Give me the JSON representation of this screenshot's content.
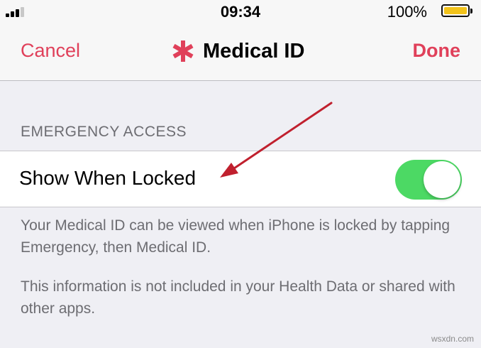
{
  "status_bar": {
    "time": "09:34",
    "battery_percent": "100%",
    "battery_level": 1.0,
    "signal_bars_filled": 3,
    "signal_bars_total": 4
  },
  "nav": {
    "cancel_label": "Cancel",
    "title": "Medical ID",
    "done_label": "Done",
    "accent_color": "#e0405a",
    "title_icon": "medical-asterisk-icon"
  },
  "section": {
    "header": "EMERGENCY ACCESS",
    "row_label": "Show When Locked",
    "toggle_on": true,
    "toggle_color": "#4cd964"
  },
  "footer": {
    "paragraph_1": "Your Medical ID can be viewed when iPhone is locked by tapping Emergency, then Medical ID.",
    "paragraph_2": "This information is not included in your Health Data or shared with other apps."
  },
  "annotation": {
    "arrow_icon": "red-arrow-icon",
    "arrow_color": "#c0202e"
  },
  "watermark": "wsxdn.com"
}
